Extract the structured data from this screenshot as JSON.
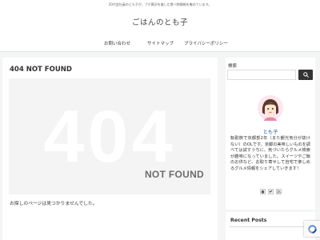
{
  "topbar": {
    "tagline": "20代会社員のとも子が、プチ贅沢を楽しむ食べ物情報を集めています。"
  },
  "header": {
    "site_title": "ごはんのとも子"
  },
  "nav": {
    "items": [
      {
        "label": "お問い合わせ"
      },
      {
        "label": "サイトマップ"
      },
      {
        "label": "プライバシーポリシー"
      }
    ]
  },
  "main": {
    "heading": "404 NOT FOUND",
    "big_number": "404",
    "not_found_label": "NOT FOUND",
    "message": "お探しのページは見つかりませんでした。"
  },
  "sidebar": {
    "search_label": "検索",
    "search_placeholder": "",
    "search_icon": "search-icon",
    "profile_name": "とも子",
    "profile_bio": "転勤族で京都部2年（また観光気分が抜けない）のOLです。京都の美味しいものを調べては試すうちに、気づいたらグルメ検索が趣味になっていました。スイーツやご飯のお供など、お取り寄せして自宅で楽しめるグルメ情報をシェアしていきます！",
    "social_icons": [
      "home-icon",
      "twitter-icon",
      "rss-icon"
    ]
  },
  "recent": {
    "heading": "Recent Posts"
  },
  "colors": {
    "page_bg": "#f4f5f5",
    "accent_dark": "#333333",
    "profile_name": "#1f5ea8",
    "notfound_box": "#f4f4f4"
  }
}
